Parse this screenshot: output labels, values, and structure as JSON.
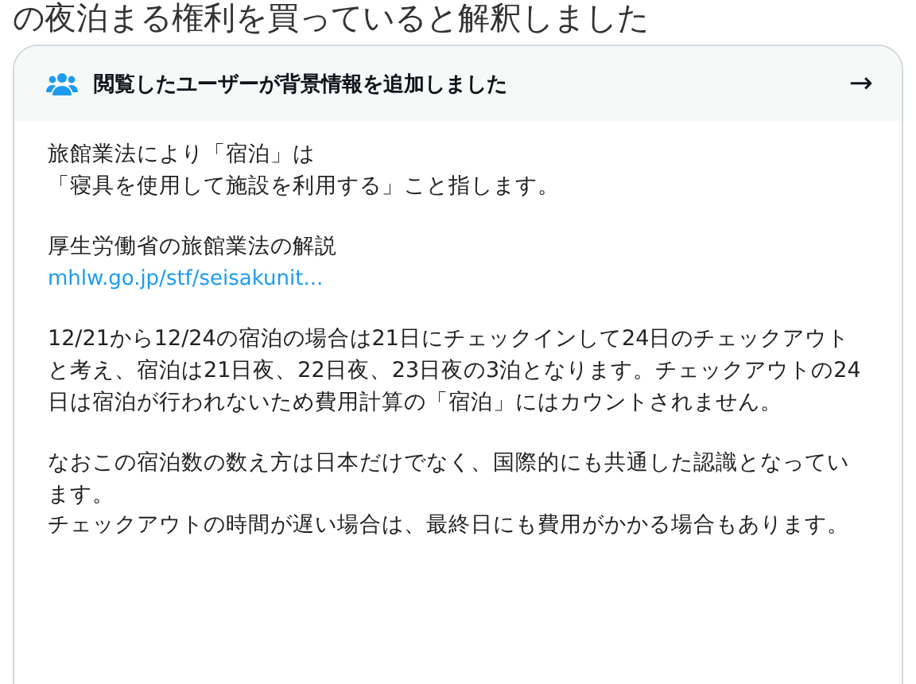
{
  "headline": "の夜泊まる権利を買っていると解釈しました",
  "note": {
    "header": {
      "title": "閲覧したユーザーが背景情報を追加しました",
      "arrow": "→"
    },
    "blocks": [
      {
        "kind": "text",
        "lines": [
          "旅館業法により「宿泊」は",
          "「寝具を使用して施設を利用する」こと指します。"
        ]
      },
      {
        "kind": "text",
        "lines": [
          "厚生労働省の旅館業法の解説"
        ],
        "link": "mhlw.go.jp/stf/seisakunit..."
      },
      {
        "kind": "text",
        "lines": [
          "12/21から12/24の宿泊の場合は21日にチェックインして24日のチェックアウトと考え、宿泊は21日夜、22日夜、23日夜の3泊となります。チェックアウトの24日は宿泊が行われないため費用計算の「宿泊」にはカウントされません。"
        ]
      },
      {
        "kind": "text",
        "lines": [
          "なおこの宿泊数の数え方は日本だけでなく、国際的にも共通した認識となっています。",
          "チェックアウトの時間が遅い場合は、最終日にも費用がかかる場合もあります。"
        ]
      }
    ]
  }
}
